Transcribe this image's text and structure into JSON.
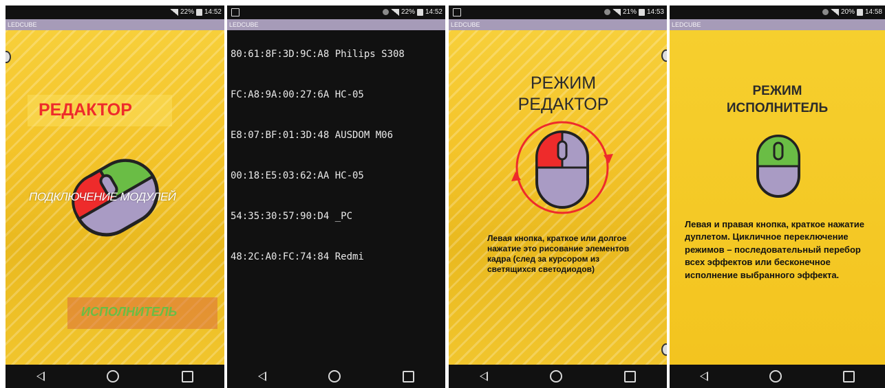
{
  "screens": [
    {
      "status": {
        "battery": "22%",
        "time": "14:52"
      },
      "app_title": "LEDCUBE",
      "editor_label": "РЕДАКТОР",
      "connect_label": "ПОДКЛЮЧЕНИЕ МОДУЛЕЙ",
      "executor_label": "ИСПОЛНИТЕЛЬ"
    },
    {
      "status": {
        "battery": "22%",
        "time": "14:52"
      },
      "app_title": "LEDCUBE",
      "devices": [
        "80:61:8F:3D:9C:A8 Philips S308",
        "FC:A8:9A:00:27:6A HC-05",
        "E8:07:BF:01:3D:48 AUSDOM M06",
        "00:18:E5:03:62:AA HC-05",
        "54:35:30:57:90:D4 _PC",
        "48:2C:A0:FC:74:84 Redmi"
      ]
    },
    {
      "status": {
        "battery": "21%",
        "time": "14:53"
      },
      "app_title": "LEDCUBE",
      "title_line1": "РЕЖИМ",
      "title_line2": "РЕДАКТОР",
      "description": "Левая кнопка, краткое или долгое нажатие это рисование элементов кадра (след  за курсором из светящихся светодиодов)"
    },
    {
      "status": {
        "battery": "20%",
        "time": "14:58"
      },
      "app_title": "LEDCUBE",
      "title_line1": "РЕЖИМ",
      "title_line2": "ИСПОЛНИТЕЛЬ",
      "description": "Левая и правая кнопка, краткое нажатие дуплетом. Цикличное переключение режимов – последовательный перебор всех эффектов или бесконечное исполнение выбранного эффекта."
    }
  ],
  "colors": {
    "red": "#ee2b2b",
    "green": "#6abd45",
    "lavender": "#a99bc4",
    "gold": "#f4c42a",
    "appbar": "#a69bb8"
  }
}
